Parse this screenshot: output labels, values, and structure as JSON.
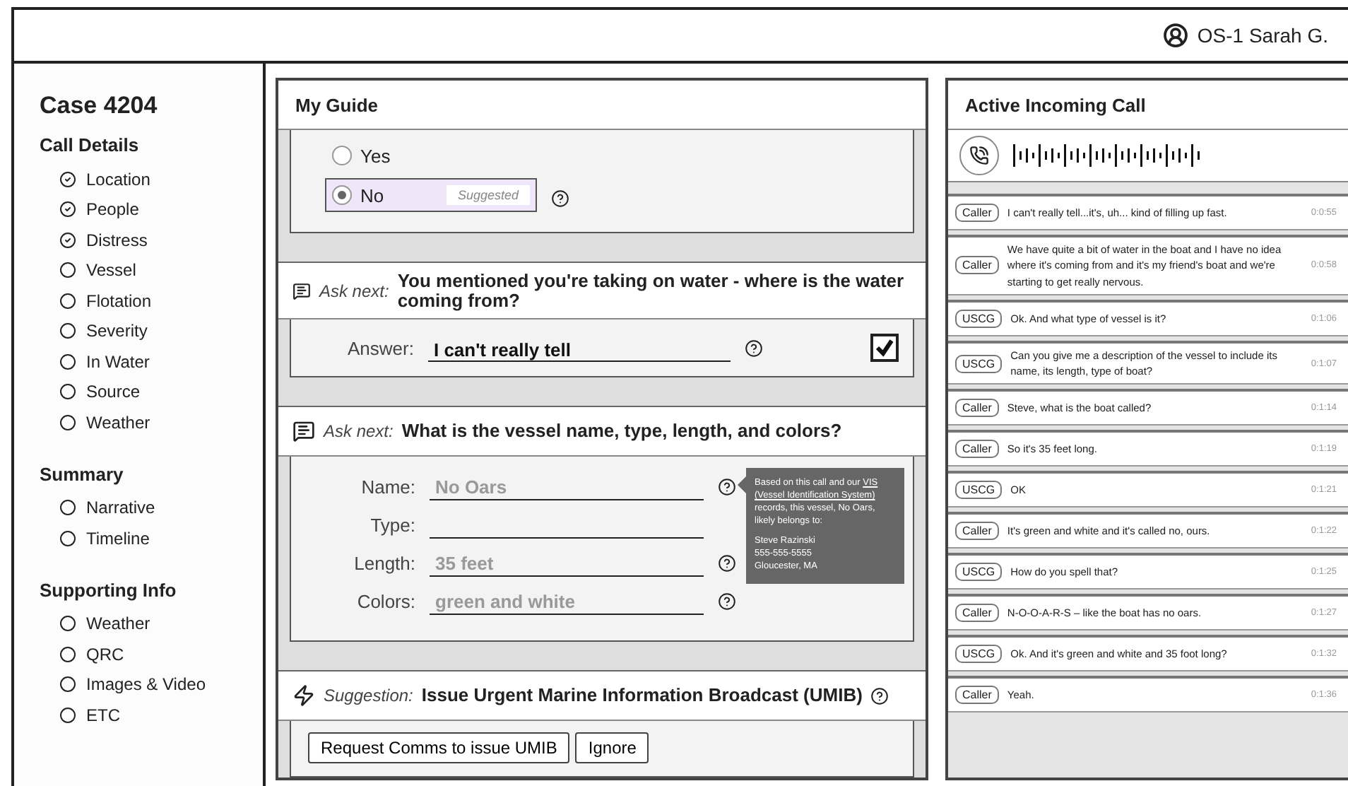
{
  "user": {
    "name": "OS-1 Sarah G."
  },
  "sidebar": {
    "title": "Case 4204",
    "sections": [
      {
        "heading": "Call Details",
        "items": [
          {
            "label": "Location",
            "done": true
          },
          {
            "label": "People",
            "done": true
          },
          {
            "label": "Distress",
            "done": true
          },
          {
            "label": "Vessel",
            "done": false
          },
          {
            "label": "Flotation",
            "done": false
          },
          {
            "label": "Severity",
            "done": false
          },
          {
            "label": "In Water",
            "done": false
          },
          {
            "label": "Source",
            "done": false
          },
          {
            "label": "Weather",
            "done": false
          }
        ]
      },
      {
        "heading": "Summary",
        "items": [
          {
            "label": "Narrative",
            "done": false
          },
          {
            "label": "Timeline",
            "done": false
          }
        ]
      },
      {
        "heading": "Supporting Info",
        "items": [
          {
            "label": "Weather",
            "done": false
          },
          {
            "label": "QRC",
            "done": false
          },
          {
            "label": "Images & Video",
            "done": false
          },
          {
            "label": "ETC",
            "done": false
          }
        ]
      }
    ]
  },
  "guide": {
    "title": "My Guide",
    "options": [
      {
        "label": "Yes",
        "selected": false
      },
      {
        "label": "No",
        "selected": true,
        "tag": "Suggested"
      }
    ],
    "question_1": {
      "prefix": "Ask next:",
      "text": "You mentioned you're taking on water - where is the water coming from?"
    },
    "answer": {
      "label": "Answer:",
      "value": "I can't really tell",
      "checked": true
    },
    "question_2": {
      "prefix": "Ask next:",
      "text": "What is the vessel name, type, length, and colors?"
    },
    "fields": [
      {
        "label": "Name:",
        "placeholder": "No Oars",
        "help": true
      },
      {
        "label": "Type:",
        "help": false
      },
      {
        "label": "Length:",
        "placeholder": "35 feet",
        "help": true
      },
      {
        "label": "Colors:",
        "placeholder": "green and white",
        "help": true
      }
    ],
    "tooltip": {
      "segments": [
        {
          "kind": "text",
          "text": "Based on this call and our"
        },
        {
          "kind": "link",
          "text": "VIS"
        },
        {
          "kind": "link",
          "text": "(Vessel Identification System)"
        },
        {
          "kind": "text",
          "text": "records, this vessel, No Oars, likely belongs to:"
        }
      ],
      "lines": [
        "Steve Razinski",
        "555-555-5555",
        "Gloucester, MA"
      ]
    },
    "suggestion": {
      "prefix": "Suggestion:",
      "text": "Issue Urgent Marine Information Broadcast (UMIB)"
    },
    "buttons": [
      "Request Comms to issue UMIB",
      "Ignore"
    ]
  },
  "call": {
    "title": "Active Incoming Call",
    "transcript": [
      {
        "speaker": "Caller",
        "text": "I can't really tell...it's, uh... kind of filling up fast.",
        "time": "0:0:55"
      },
      {
        "speaker": "Caller",
        "text": "We have quite a bit of water in the boat and I have no idea where it's coming from and it's my friend's boat and we're starting to get really nervous.",
        "time": "0:0:58"
      },
      {
        "speaker": "USCG",
        "text": "Ok. And what type of vessel is it?",
        "time": "0:1:06"
      },
      {
        "speaker": "USCG",
        "text": "Can you give me a description of the vessel to include its name, its length, type of boat?",
        "time": "0:1:07"
      },
      {
        "speaker": "Caller",
        "text": "Steve, what is the boat called?",
        "time": "0:1:14"
      },
      {
        "speaker": "Caller",
        "text": "So it's 35 feet long.",
        "time": "0:1:19"
      },
      {
        "speaker": "USCG",
        "text": "OK",
        "time": "0:1:21"
      },
      {
        "speaker": "Caller",
        "text": "It's green and white and it's called no, ours.",
        "time": "0:1:22"
      },
      {
        "speaker": "USCG",
        "text": "How do you spell that?",
        "time": "0:1:25"
      },
      {
        "speaker": "Caller",
        "text": "N-O-O-A-R-S – like the boat has no oars.",
        "time": "0:1:27"
      },
      {
        "speaker": "USCG",
        "text": "Ok. And it's green and white and 35 foot long?",
        "time": "0:1:32"
      },
      {
        "speaker": "Caller",
        "text": "Yeah.",
        "time": "0:1:36"
      }
    ]
  }
}
